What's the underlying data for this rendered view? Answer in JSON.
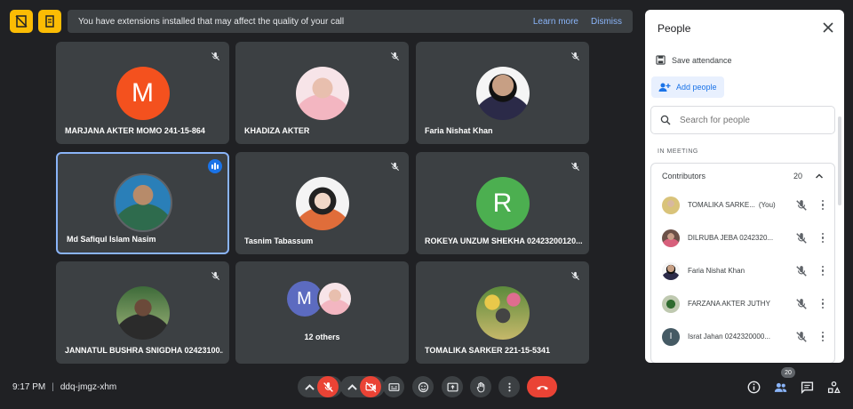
{
  "banner": {
    "message": "You have extensions installed that may affect the quality of your call",
    "learn_more": "Learn more",
    "dismiss": "Dismiss"
  },
  "tiles": [
    {
      "name": "MARJANA AKTER MOMO 241-15-864",
      "avatar_letter": "M",
      "avatar_color": "#f4511e",
      "muted": true
    },
    {
      "name": "KHADIZA AKTER",
      "muted": true
    },
    {
      "name": "Faria Nishat Khan",
      "muted": true
    },
    {
      "name": "Md Safiqul Islam Nasim",
      "speaking": true
    },
    {
      "name": "Tasnim Tabassum",
      "muted": true
    },
    {
      "name": "ROKEYA UNZUM SHEKHA 02423200120...",
      "avatar_letter": "R",
      "avatar_color": "#4caf50",
      "muted": true
    },
    {
      "name": "JANNATUL BUSHRA SNIGDHA 02423100...",
      "muted": true
    },
    {
      "name": "12 others",
      "avatar_letter": "M"
    },
    {
      "name": "TOMALIKA SARKER 221-15-5341",
      "muted": true
    }
  ],
  "panel": {
    "title": "People",
    "save_attendance": "Save attendance",
    "add_people": "Add people",
    "search_placeholder": "Search for people",
    "in_meeting": "IN MEETING",
    "contributors_label": "Contributors",
    "contributors_count": "20",
    "people": [
      {
        "name": "TOMALIKA SARKE...",
        "suffix": "(You)"
      },
      {
        "name": "DILRUBA JEBA 0242320..."
      },
      {
        "name": "Faria Nishat Khan"
      },
      {
        "name": "FARZANA AKTER JUTHY"
      },
      {
        "name": "Israt Jahan 0242320000...",
        "avatar_letter": "I"
      }
    ]
  },
  "bottom": {
    "time": "9:17 PM",
    "meeting_code": "ddq-jmgz-xhm",
    "people_count": "20"
  },
  "colors": {
    "accent": "#1a73e8",
    "danger": "#ea4335",
    "banner_warning": "#fbbc04"
  }
}
